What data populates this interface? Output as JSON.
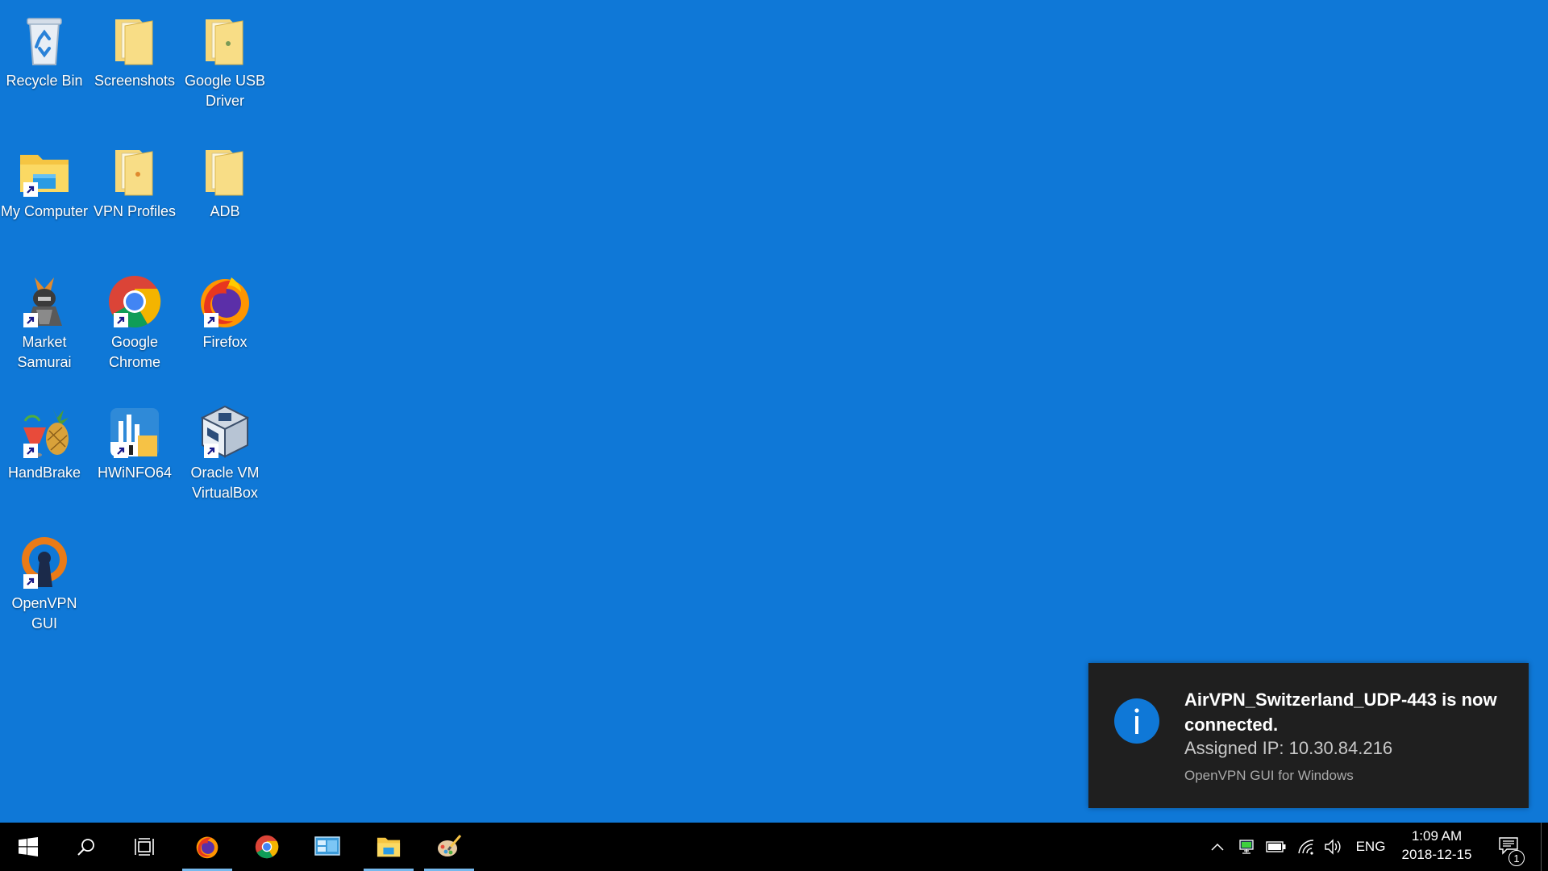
{
  "desktop": {
    "icons": [
      {
        "label": "Recycle Bin",
        "icon": "recycle-bin-icon"
      },
      {
        "label": "Screenshots",
        "icon": "folder-icon"
      },
      {
        "label": "Google USB Driver",
        "icon": "folder-icon"
      },
      {
        "label": "My Computer",
        "icon": "file-explorer-icon"
      },
      {
        "label": "VPN Profiles",
        "icon": "folder-icon"
      },
      {
        "label": "ADB",
        "icon": "folder-icon"
      },
      {
        "label": "Market Samurai",
        "icon": "samurai-icon"
      },
      {
        "label": "Google Chrome",
        "icon": "chrome-icon"
      },
      {
        "label": "Firefox",
        "icon": "firefox-icon"
      },
      {
        "label": "HandBrake",
        "icon": "handbrake-icon"
      },
      {
        "label": "HWiNFO64",
        "icon": "hwinfo-icon"
      },
      {
        "label": "Oracle VM VirtualBox",
        "icon": "virtualbox-icon"
      },
      {
        "label": "OpenVPN GUI",
        "icon": "openvpn-icon"
      }
    ]
  },
  "toast": {
    "title": "AirVPN_Switzerland_UDP-443 is now connected.",
    "body": "Assigned IP: 10.30.84.216",
    "attribution": "OpenVPN GUI for Windows",
    "icon": "info-icon",
    "accent": "#0f78d7"
  },
  "taskbar": {
    "pinned": [
      "start-icon",
      "search-icon",
      "task-view-icon",
      "firefox-icon",
      "chrome-icon",
      "control-panel-icon",
      "file-explorer-icon",
      "paint-icon"
    ],
    "tray": {
      "language": "ENG",
      "time": "1:09 AM",
      "date": "2018-12-15",
      "notification_count": "1"
    }
  },
  "colors": {
    "desktop_bg": "#0f78d7",
    "taskbar_bg": "#000000",
    "toast_bg": "#1f1f1f",
    "running_indicator": "#76b9ed"
  }
}
